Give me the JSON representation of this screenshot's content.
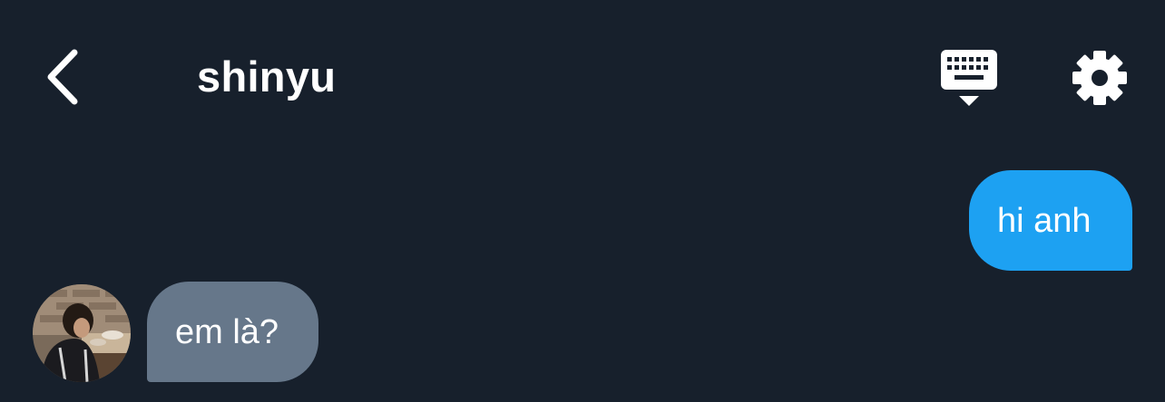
{
  "header": {
    "title": "shinyu",
    "back_icon": "chevron-left-icon",
    "keyboard_icon": "keyboard-dropdown-icon",
    "settings_icon": "gear-icon"
  },
  "messages": [
    {
      "direction": "outgoing",
      "text": "hi anh"
    },
    {
      "direction": "incoming",
      "text": "em là?"
    }
  ],
  "colors": {
    "background": "#17202c",
    "outgoing_bubble": "#1da1f2",
    "incoming_bubble": "#66778a",
    "text": "#ffffff"
  }
}
